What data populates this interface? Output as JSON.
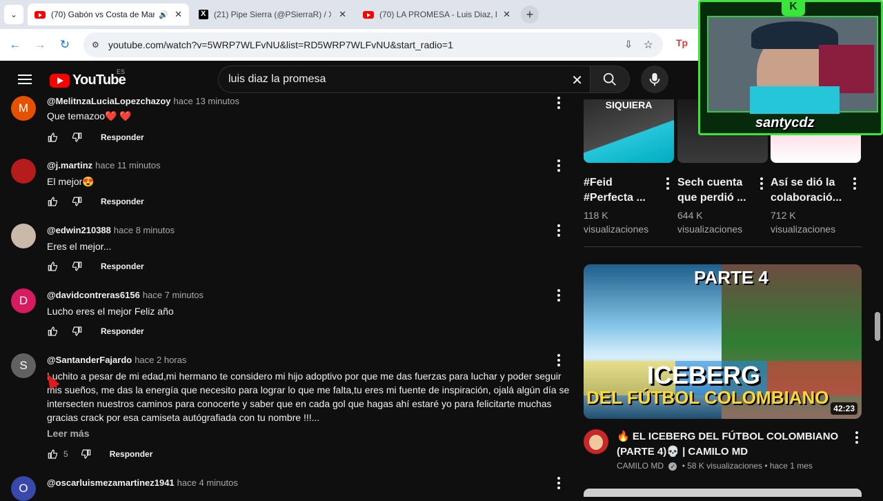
{
  "browser": {
    "tabs": [
      {
        "title": "(70) Gabón vs Costa de Mar",
        "active": true,
        "close": "✕"
      },
      {
        "title": "(21) Pipe Sierra (@PSierraR) / X",
        "active": false,
        "close": "✕"
      },
      {
        "title": "(70) LA PROMESA - Luis Diaz, lu",
        "active": false,
        "close": "✕"
      }
    ],
    "new_tab": "+",
    "url": "youtube.com/watch?v=5WRP7WLFvNU&list=RD5WRP7WLFvNU&start_radio=1"
  },
  "youtube": {
    "logo_text": "YouTube",
    "country": "ES",
    "search_query": "luis diaz la promesa"
  },
  "comments": [
    {
      "author": "@MelitnzaLuciaLopezchazoy",
      "time": "hace 13 minutos",
      "text": "Que temazoo❤️ ❤️",
      "avatar_letter": "M",
      "avatar_color": "#e65100",
      "likes": ""
    },
    {
      "author": "@j.martinz",
      "time": "hace 11 minutos",
      "text": "El mejor😍",
      "avatar_letter": "",
      "avatar_color": "#b71c1c",
      "likes": ""
    },
    {
      "author": "@edwin210388",
      "time": "hace 8 minutos",
      "text": "Eres el mejor...",
      "avatar_letter": "",
      "avatar_color": "#c9b9a8",
      "likes": ""
    },
    {
      "author": "@davidcontreras6156",
      "time": "hace 7 minutos",
      "text": "Lucho eres el mejor Feliz año",
      "avatar_letter": "D",
      "avatar_color": "#d81b60",
      "likes": ""
    },
    {
      "author": "@SantanderFajardo",
      "time": "hace 2 horas",
      "text": "Luchito a pesar de mi edad,mi hermano te considero mi hijo adoptivo por que me das fuerzas para luchar y poder seguir mis sueños, me das  la energía que necesito para lograr lo que me falta,tu eres mi fuente de inspiración, ojalá algún día se intersecten nuestros caminos para conocerte y saber que en cada gol que hagas ahí estaré yo para felicitarte muchas gracias crack por esa camiseta autógrafiada con tu nombre !!!...",
      "avatar_letter": "S",
      "avatar_color": "#616161",
      "likes": "5"
    },
    {
      "author": "@oscarluismezamartinez1941",
      "time": "hace 4 minutos",
      "text": "",
      "avatar_letter": "O",
      "avatar_color": "#3949ab",
      "likes": ""
    }
  ],
  "labels": {
    "reply": "Responder",
    "read_more": "Leer más"
  },
  "shorts": [
    {
      "title": "#Feid #Perfecta ...",
      "views_count": "118 K",
      "views_word": "visualizaciones",
      "thumb_text": "SIQUIERA"
    },
    {
      "title": "Sech cuenta que perdió ...",
      "views_count": "644 K",
      "views_word": "visualizaciones",
      "thumb_text": ""
    },
    {
      "title": "Así se dió la colaboració...",
      "views_count": "712 K",
      "views_word": "visualizaciones",
      "thumb_text": ""
    }
  ],
  "video": {
    "title": "🔥 EL ICEBERG DEL FÚTBOL COLOMBIANO (PARTE 4)💀 | CAMILO MD",
    "channel": "CAMILO MD",
    "views": "58 K visualizaciones",
    "age": "hace 1 mes",
    "duration": "42:23",
    "thumb_top": "PARTE 4",
    "thumb_main": "ICEBERG",
    "thumb_sub": "DEL FÚTBOL COLOMBIANO"
  },
  "webcam": {
    "name": "santycdz",
    "badge": "K"
  },
  "colors": {
    "accent_red": "#ff0000",
    "webcam_green": "#39e639"
  }
}
